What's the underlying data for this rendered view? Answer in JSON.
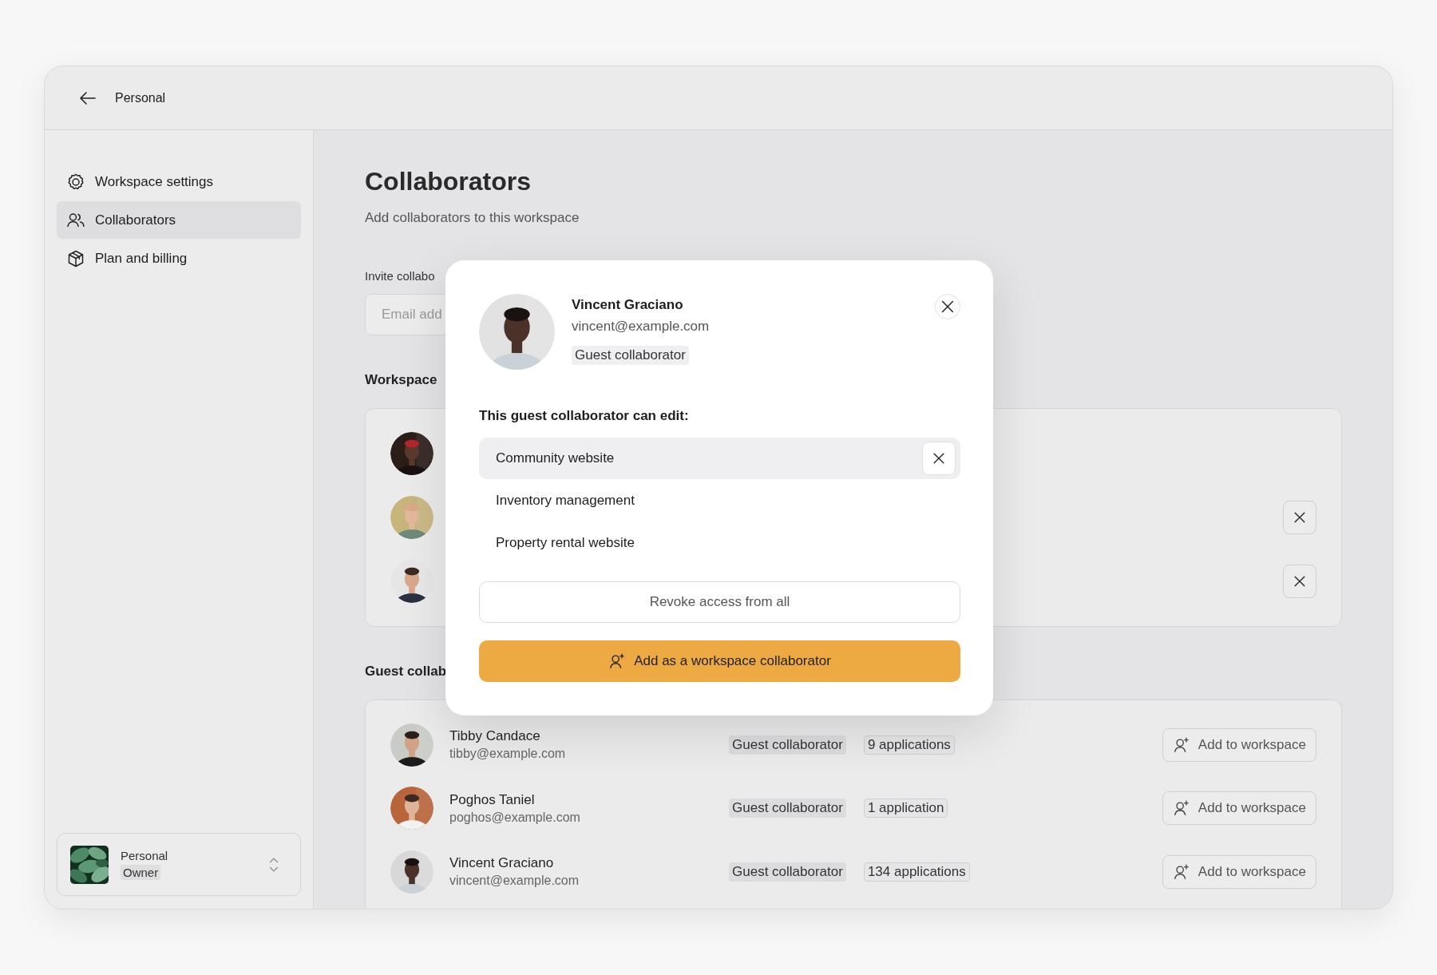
{
  "header": {
    "back_label": "Personal"
  },
  "sidebar": {
    "items": [
      {
        "label": "Workspace settings",
        "kind": "settings",
        "selected": false
      },
      {
        "label": "Collaborators",
        "kind": "collaborators",
        "selected": true
      },
      {
        "label": "Plan and billing",
        "kind": "billing",
        "selected": false
      }
    ],
    "account": {
      "name": "Personal",
      "role": "Owner"
    }
  },
  "page": {
    "title": "Collaborators",
    "subtitle": "Add collaborators to this workspace"
  },
  "invite": {
    "label": "Invite collabo",
    "placeholder": "Email add"
  },
  "workspace_section": {
    "heading": "Workspace",
    "members": [
      {
        "removable": false
      },
      {
        "removable": true
      },
      {
        "removable": true
      }
    ]
  },
  "guest_section": {
    "heading": "Guest collab",
    "guests": [
      {
        "name": "Tibby Candace",
        "email": "tibby@example.com",
        "role": "Guest collaborator",
        "applications": "9 applications",
        "action": "Add to workspace"
      },
      {
        "name": "Poghos Taniel",
        "email": "poghos@example.com",
        "role": "Guest collaborator",
        "applications": "1 application",
        "action": "Add to workspace"
      },
      {
        "name": "Vincent Graciano",
        "email": "vincent@example.com",
        "role": "Guest collaborator",
        "applications": "134 applications",
        "action": "Add to workspace"
      }
    ]
  },
  "dialog": {
    "name": "Vincent Graciano",
    "email": "vincent@example.com",
    "role": "Guest collaborator",
    "section_title": "This guest collaborator can edit:",
    "projects": [
      {
        "label": "Community website",
        "selected": true
      },
      {
        "label": "Inventory management",
        "selected": false
      },
      {
        "label": "Property rental website",
        "selected": false
      }
    ],
    "revoke_button": "Revoke access from all",
    "add_button": "Add as a workspace collaborator"
  }
}
